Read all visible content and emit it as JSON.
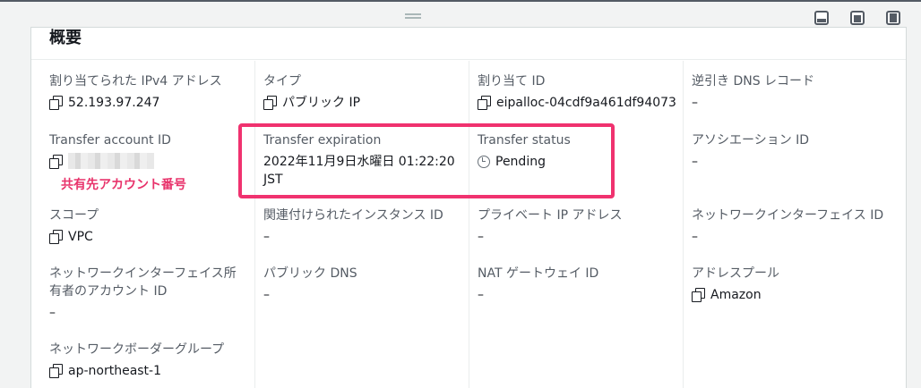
{
  "panel": {
    "title": "概要"
  },
  "fields": {
    "ipv4": {
      "label": "割り当てられた IPv4 アドレス",
      "value": "52.193.97.247"
    },
    "type": {
      "label": "タイプ",
      "value": "パブリック IP"
    },
    "alloc_id": {
      "label": "割り当て ID",
      "value": "eipalloc-04cdf9a461df94073"
    },
    "reverse_dns": {
      "label": "逆引き DNS レコード",
      "value": "–"
    },
    "transfer_account": {
      "label": "Transfer account ID",
      "value": ""
    },
    "transfer_expiration": {
      "label": "Transfer expiration",
      "value": "2022年11月9日水曜日 01:22:20 JST"
    },
    "transfer_status": {
      "label": "Transfer status",
      "value": "Pending"
    },
    "association_id": {
      "label": "アソシエーション ID",
      "value": "–"
    },
    "scope": {
      "label": "スコープ",
      "value": "VPC"
    },
    "instance_id": {
      "label": "関連付けられたインスタンス ID",
      "value": "–"
    },
    "private_ip": {
      "label": "プライベート IP アドレス",
      "value": "–"
    },
    "eni_id": {
      "label": "ネットワークインターフェイス ID",
      "value": "–"
    },
    "eni_owner": {
      "label": "ネットワークインターフェイス所有者のアカウント ID",
      "value": "–"
    },
    "public_dns": {
      "label": "パブリック DNS",
      "value": "–"
    },
    "nat_gw": {
      "label": "NAT ゲートウェイ ID",
      "value": "–"
    },
    "address_pool": {
      "label": "アドレスプール",
      "value": "Amazon"
    },
    "border_group": {
      "label": "ネットワークボーダーグループ",
      "value": "ap-northeast-1"
    }
  },
  "annotation": {
    "text": "共有先アカウント番号",
    "color": "#e8336b"
  },
  "icons": {
    "copy": "copy-icon",
    "status": "clock-icon"
  },
  "colors": {
    "highlight": "#f0326f",
    "label": "#545b64",
    "text": "#16191f"
  }
}
